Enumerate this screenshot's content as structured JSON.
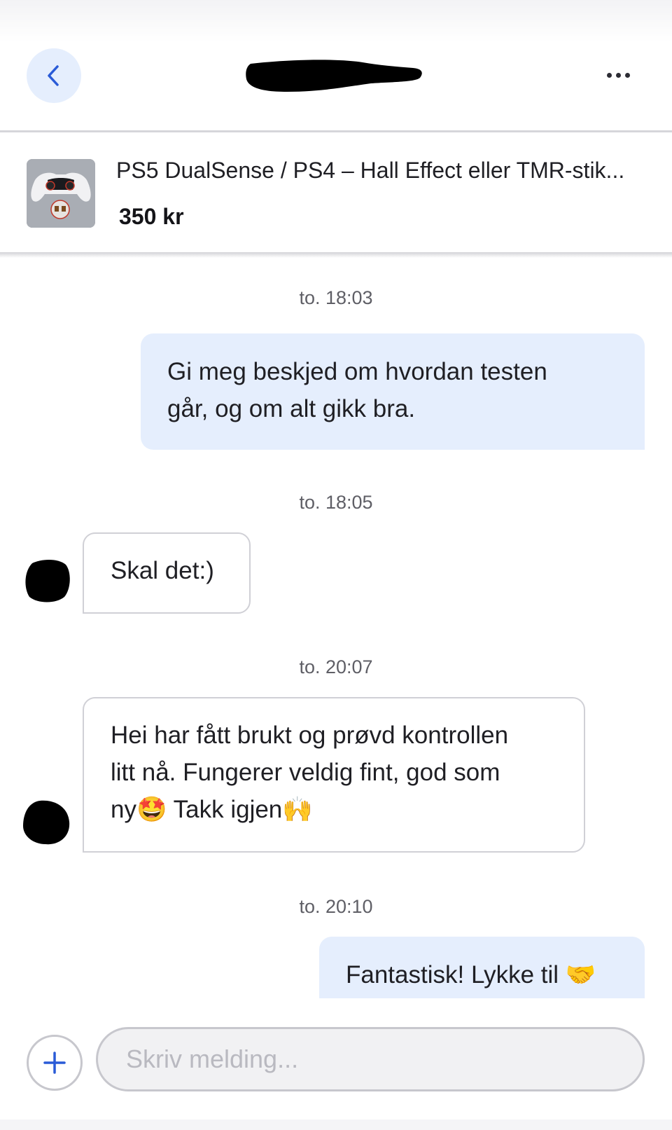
{
  "header": {
    "back_icon": "chevron-left-icon",
    "title_redacted": true,
    "more_icon": "more-horizontal-icon"
  },
  "listing": {
    "title": "PS5 DualSense / PS4 – Hall Effect eller TMR-stik...",
    "price": "350 kr",
    "image": "controller-thumbnail"
  },
  "messages": [
    {
      "timestamp": "to. 18:03",
      "direction": "out",
      "text_lines": [
        "Gi meg beskjed om hvordan testen",
        "går, og om alt gikk bra."
      ]
    },
    {
      "timestamp": "to. 18:05",
      "direction": "in",
      "text_lines": [
        "Skal det:)"
      ]
    },
    {
      "timestamp": "to. 20:07",
      "direction": "in",
      "text_lines": [
        "Hei har fått brukt og prøvd kontrollen",
        "litt nå. Fungerer veldig fint, god som",
        "ny🤩 Takk igjen🙌"
      ]
    },
    {
      "timestamp": "to. 20:10",
      "direction": "out",
      "text_lines": [
        "Fantastisk! Lykke til 🤝"
      ]
    }
  ],
  "composer": {
    "add_icon": "plus-icon",
    "placeholder": "Skriv melding..."
  },
  "colors": {
    "accent": "#2a5bd7",
    "outgoing_bubble": "#e5eefd",
    "incoming_border": "#d0d0d6"
  }
}
